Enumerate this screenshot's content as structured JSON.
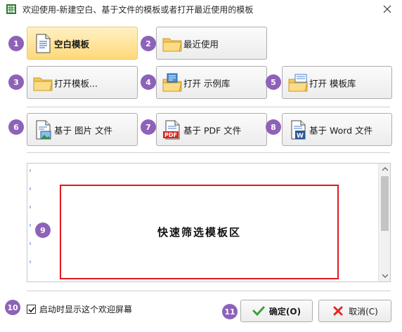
{
  "window": {
    "title": "欢迎使用-新建空白、基于文件的模板或者打开最近使用的模板",
    "app_icon": "spreadsheet-icon",
    "close_icon": "close-icon"
  },
  "buttons": {
    "blank": {
      "label": "空白模板",
      "icon": "blank-document-icon",
      "badge": "1"
    },
    "recent": {
      "label": "最近使用",
      "icon": "folder-icon",
      "badge": "2"
    },
    "open_template": {
      "label": "打开模板...",
      "icon": "folder-icon",
      "badge": "3"
    },
    "open_sample": {
      "label": "打开 示例库",
      "icon": "sample-folder-icon",
      "badge": "4"
    },
    "open_library": {
      "label": "打开 模板库",
      "icon": "library-folder-icon",
      "badge": "5"
    },
    "from_image": {
      "label": "基于 图片 文件",
      "icon": "image-file-icon",
      "badge": "6"
    },
    "from_pdf": {
      "label": "基于 PDF 文件",
      "icon": "pdf-file-icon",
      "badge": "7",
      "icon_text": "PDF"
    },
    "from_word": {
      "label": "基于 Word 文件",
      "icon": "word-file-icon",
      "badge": "8",
      "icon_text": "W"
    }
  },
  "filter_area": {
    "label": "快速筛选模板区",
    "badge": "9"
  },
  "startup": {
    "label": "启动时显示这个欢迎屏幕",
    "checked": true,
    "badge": "10"
  },
  "ok_button": {
    "label": "确定(O)",
    "icon": "check-icon",
    "badge": "11"
  },
  "cancel_button": {
    "label": "取消(C)",
    "icon": "cross-icon"
  },
  "colors": {
    "badge": "#8d62b8",
    "selected_button": "#ffd97a",
    "highlight_border": "#e0181f"
  }
}
